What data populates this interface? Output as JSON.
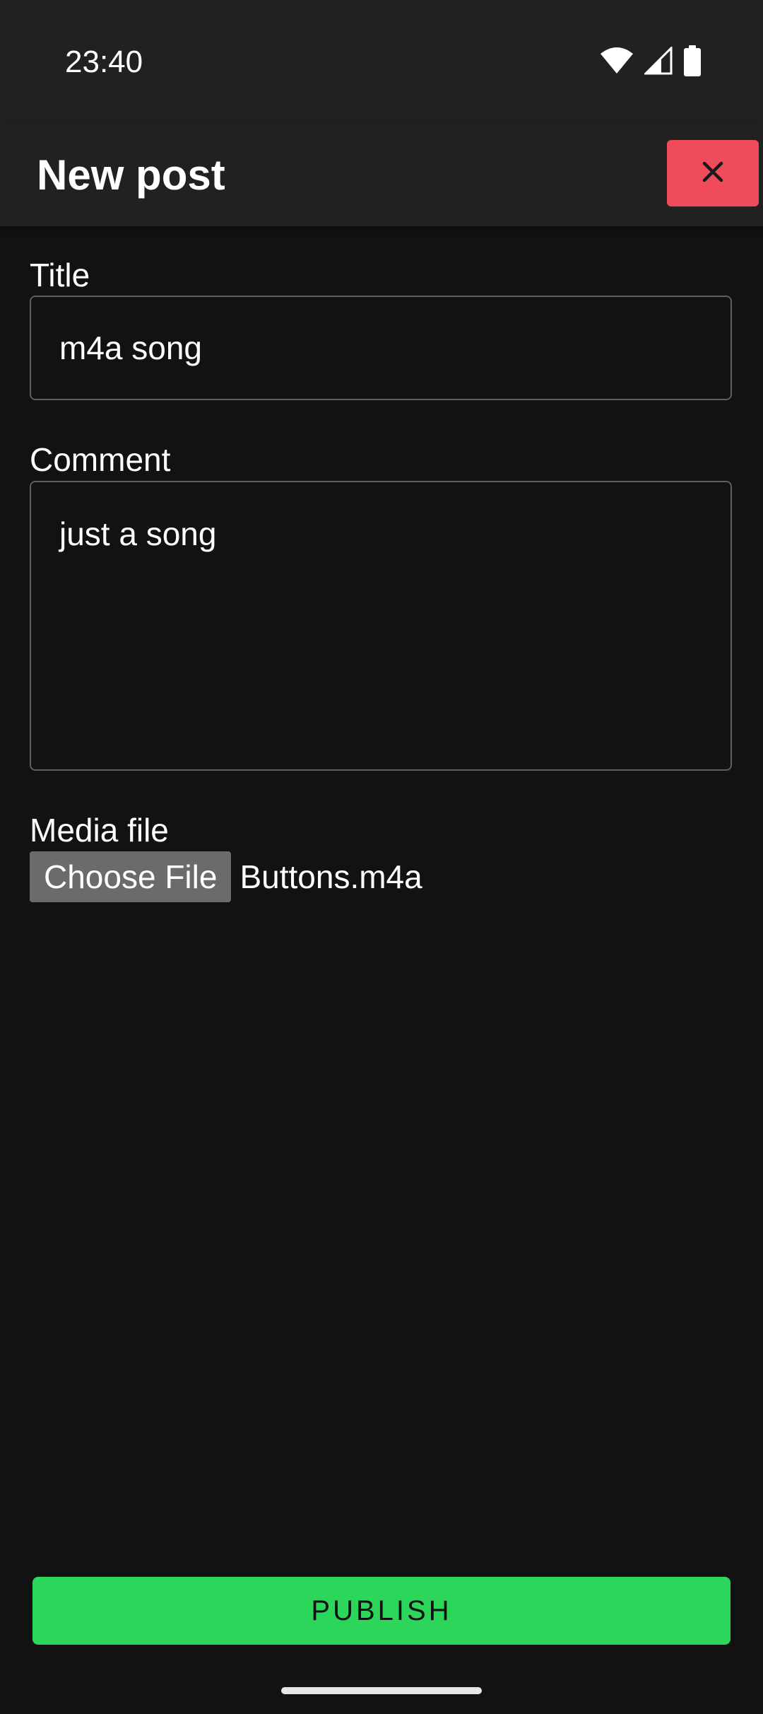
{
  "status_bar": {
    "time": "23:40",
    "icons": [
      "wifi-icon",
      "signal-icon",
      "battery-icon"
    ]
  },
  "app_bar": {
    "title": "New post",
    "close_icon": "close-icon"
  },
  "form": {
    "title_label": "Title",
    "title_value": "m4a song",
    "comment_label": "Comment",
    "comment_value": "just a song",
    "media_label": "Media file",
    "choose_file_label": "Choose File",
    "file_name": "Buttons.m4a"
  },
  "publish_label": "PUBLISH",
  "colors": {
    "background": "#121212",
    "app_bar": "#212121",
    "close_button": "#f04b5b",
    "publish_button": "#2bd65b",
    "choose_file_button": "#6b6b6b"
  }
}
